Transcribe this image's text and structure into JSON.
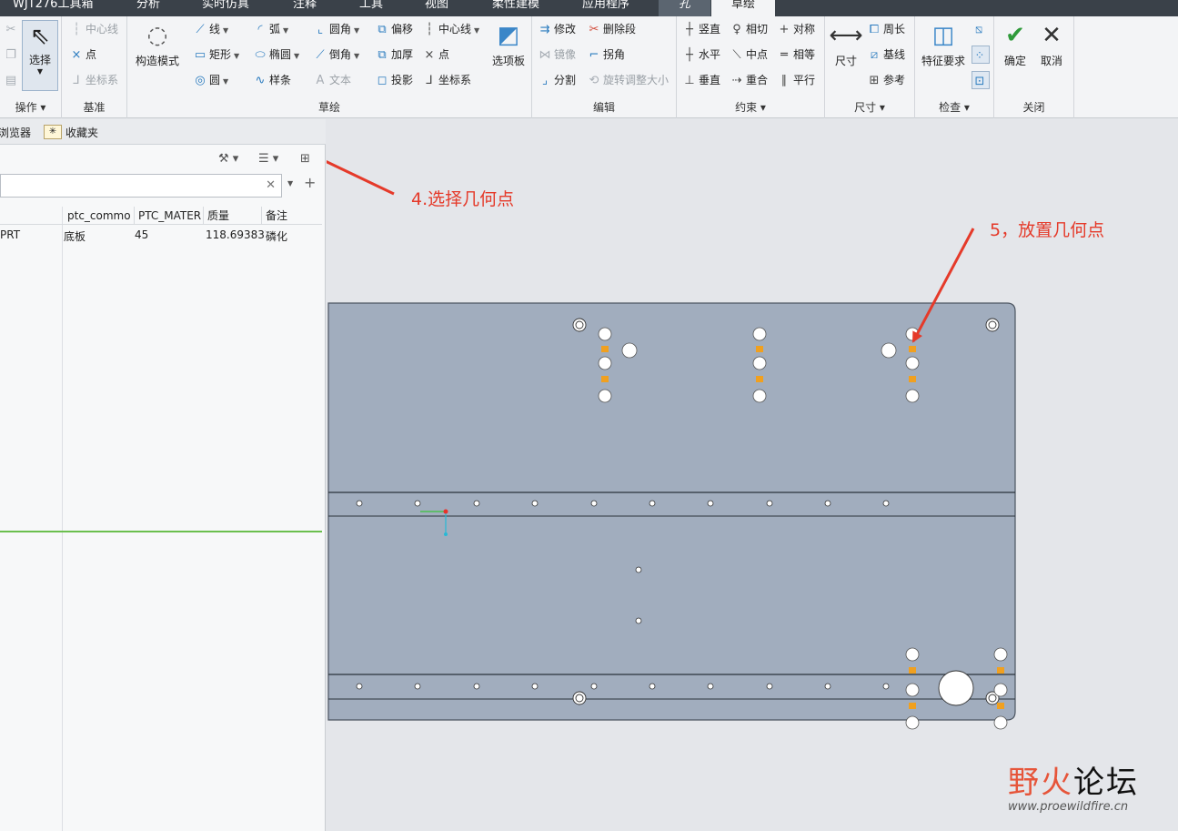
{
  "topbar": {
    "tabs": [
      "WJT276工具箱",
      "分析",
      "实时仿真",
      "注释",
      "工具",
      "视图",
      "柔性建模",
      "应用程序",
      "孔",
      "草绘"
    ]
  },
  "ribbon": {
    "ops": {
      "label": "操作",
      "select": "选择"
    },
    "datum": {
      "label": "基准",
      "centerline": "中心线",
      "point": "点",
      "csys": "坐标系"
    },
    "construct": "构造模式",
    "sketch": {
      "label": "草绘",
      "line": "线",
      "arc": "弧",
      "fillet": "圆角",
      "offset": "偏移",
      "centerline": "中心线",
      "rect": "矩形",
      "ellipse": "椭圆",
      "chamfer": "倒角",
      "thicken": "加厚",
      "point": "点",
      "circle": "圆",
      "spline": "样条",
      "text": "文本",
      "project": "投影",
      "csys": "坐标系"
    },
    "palette": "选项板",
    "edit": {
      "label": "编辑",
      "modify": "修改",
      "delete_seg": "删除段",
      "mirror": "镜像",
      "corner": "拐角",
      "divide": "分割",
      "rotate_resize": "旋转调整大小"
    },
    "constrain": {
      "label": "约束",
      "vertical": "竖直",
      "tangent": "相切",
      "symmetric": "对称",
      "horizontal": "水平",
      "midpoint": "中点",
      "equal": "相等",
      "perpendicular": "垂直",
      "coincident": "重合",
      "parallel": "平行"
    },
    "dimension": {
      "label": "尺寸",
      "dim": "尺寸",
      "perimeter": "周长",
      "baseline": "基线",
      "reference": "参考"
    },
    "inspect": {
      "label": "检查",
      "feature_req": "特征要求"
    },
    "close": {
      "label": "关闭",
      "ok": "确定",
      "cancel": "取消"
    }
  },
  "left_panel": {
    "tabs": [
      "浏览器",
      "收藏夹"
    ],
    "columns": [
      "ptc_commo",
      "PTC_MATER",
      "质量",
      "备注"
    ],
    "row": [
      "PRT",
      "底板",
      "45",
      "118.693837",
      "磷化"
    ]
  },
  "annotations": {
    "step4": "4.选择几何点",
    "step5": "5，放置几何点"
  },
  "watermark": {
    "main_a": "野火",
    "main_b": "论坛",
    "url": "www.proewildfire.cn"
  },
  "colors": {
    "accent": "#e53a2a",
    "plate": "#a1adbe",
    "green": "#6bbf4e"
  }
}
